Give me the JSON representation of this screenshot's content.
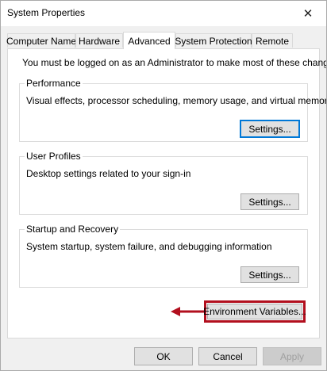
{
  "window": {
    "title": "System Properties",
    "close_glyph": "✕"
  },
  "tabs": [
    {
      "label": "Computer Name",
      "active": false
    },
    {
      "label": "Hardware",
      "active": false
    },
    {
      "label": "Advanced",
      "active": true
    },
    {
      "label": "System Protection",
      "active": false
    },
    {
      "label": "Remote",
      "active": false
    }
  ],
  "advanced": {
    "admin_note": "You must be logged on as an Administrator to make most of these changes.",
    "performance": {
      "title": "Performance",
      "description": "Visual effects, processor scheduling, memory usage, and virtual memory",
      "button": "Settings..."
    },
    "user_profiles": {
      "title": "User Profiles",
      "description": "Desktop settings related to your sign-in",
      "button": "Settings..."
    },
    "startup_recovery": {
      "title": "Startup and Recovery",
      "description": "System startup, system failure, and debugging information",
      "button": "Settings..."
    },
    "environment_variables_button": "Environment Variables..."
  },
  "footer": {
    "ok": "OK",
    "cancel": "Cancel",
    "apply": "Apply"
  },
  "colors": {
    "highlight": "#b20f1e",
    "focus": "#0078d7"
  }
}
